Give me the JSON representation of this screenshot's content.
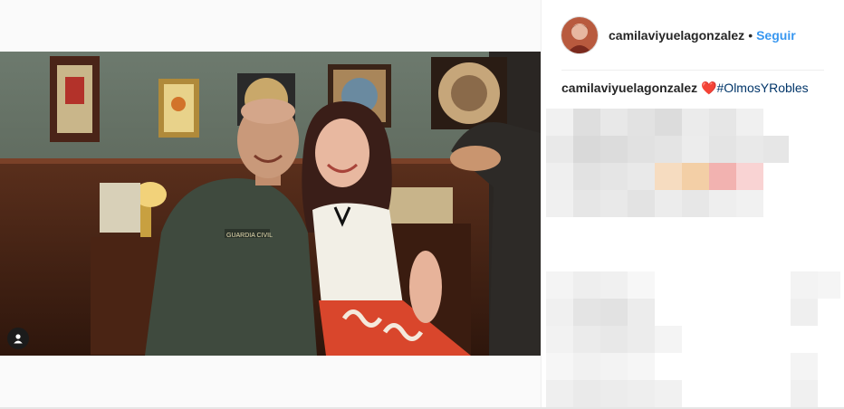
{
  "post": {
    "username": "camilaviyuelagonzalez",
    "separator": "•",
    "follow_label": "Seguir",
    "caption_username": "camilaviyuelagonzalez",
    "caption_heart": "❤️",
    "caption_hashtag": "#OlmosYRobles",
    "uniform_text": "GUARDIA CIVIL"
  },
  "icons": {
    "tag": "person-tag-icon",
    "avatar": "profile-avatar"
  },
  "colors": {
    "link": "#3897f0",
    "text": "#262626",
    "hashtag": "#003569"
  }
}
